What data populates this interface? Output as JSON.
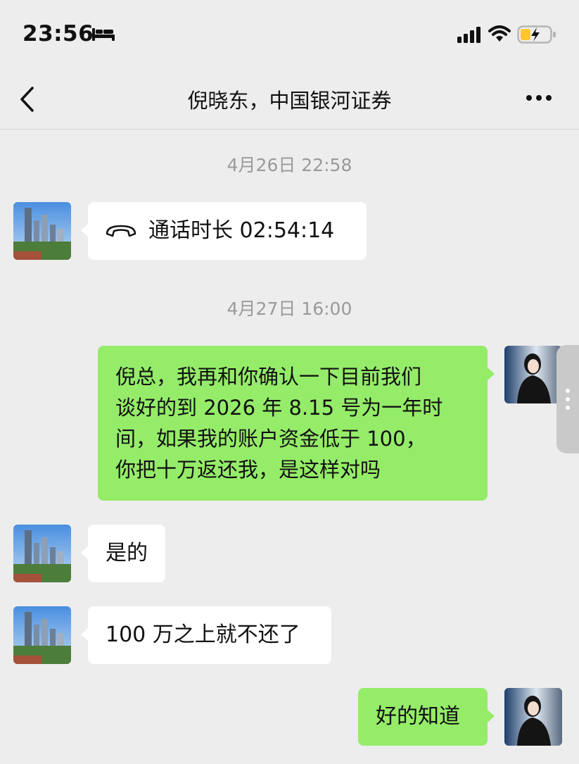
{
  "status_bar": {
    "time": "23:56",
    "icons": [
      "bed-icon",
      "signal-icon",
      "wifi-icon",
      "battery-charging-icon"
    ]
  },
  "nav": {
    "title": "倪晓东，中国银河证券",
    "back_icon": "chevron-left-icon",
    "more_icon": "more-dots-icon"
  },
  "colors": {
    "background": "#ededed",
    "bubble_self": "#95ec69",
    "bubble_other": "#ffffff",
    "timestamp_text": "#9a9a9a",
    "battery_fill": "#ffc62e"
  },
  "messages": [
    {
      "type": "timestamp",
      "text": "4月26日 22:58"
    },
    {
      "type": "call",
      "from": "contact",
      "text": "通话时长 02:54:14",
      "icon": "phone-hangup-icon"
    },
    {
      "type": "timestamp",
      "text": "4月27日 16:00"
    },
    {
      "type": "text",
      "from": "me",
      "lines": [
        "倪总，我再和你确认一下目前我们",
        "谈好的到 2026 年 8.15 号为一年时",
        "间，如果我的账户资金低于 100，",
        "你把十万返还我，是这样对吗"
      ]
    },
    {
      "type": "text",
      "from": "contact",
      "text": "是的"
    },
    {
      "type": "text",
      "from": "contact",
      "text": "100 万之上就不还了"
    },
    {
      "type": "text",
      "from": "me",
      "text": "好的知道"
    }
  ]
}
